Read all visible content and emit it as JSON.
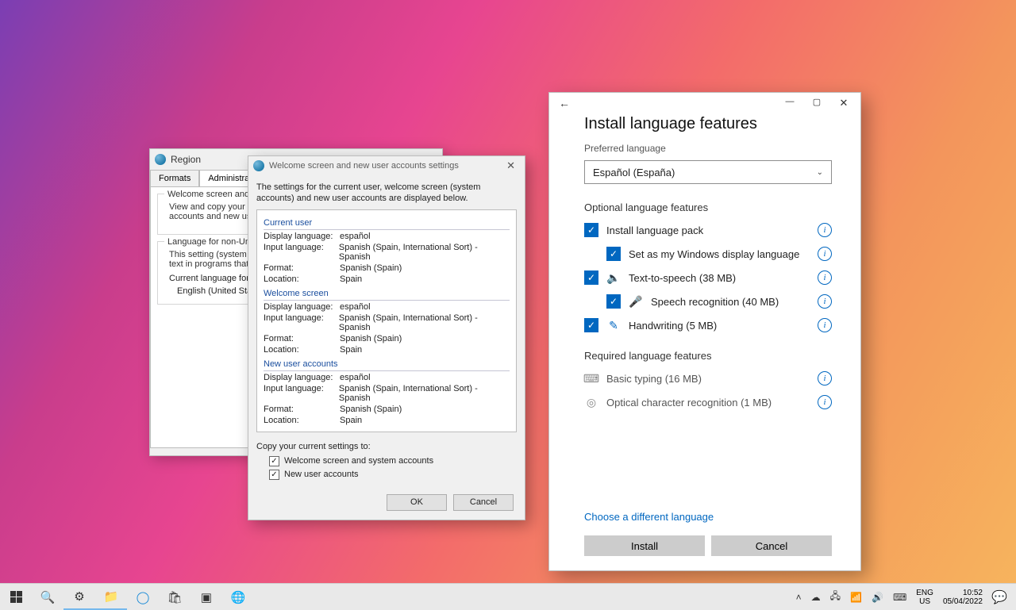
{
  "region_window": {
    "title": "Region",
    "tabs": {
      "formats": "Formats",
      "administrative": "Administrative"
    },
    "group1_title": "Welcome screen and new",
    "group1_desc": "View and copy your inte\naccounts and new user a",
    "group2_title": "Language for non-Unico",
    "group2_desc1": "This setting (system loca\ntext in programs that do",
    "group2_line3": "Current language for no",
    "group2_line4": "English (United State"
  },
  "welcome_dialog": {
    "title": "Welcome screen and new user accounts settings",
    "intro": "The settings for the current user, welcome screen (system accounts) and new user accounts are displayed below.",
    "sections": {
      "current": {
        "heading": "Current user",
        "display_language_k": "Display language:",
        "display_language_v": "español",
        "input_language_k": "Input language:",
        "input_language_v": "Spanish (Spain, International Sort) - Spanish",
        "format_k": "Format:",
        "format_v": "Spanish (Spain)",
        "location_k": "Location:",
        "location_v": "Spain"
      },
      "welcome": {
        "heading": "Welcome screen",
        "display_language_v": "español",
        "input_language_v": "Spanish (Spain, International Sort) - Spanish",
        "format_v": "Spanish (Spain)",
        "location_v": "Spain"
      },
      "newuser": {
        "heading": "New user accounts",
        "display_language_v": "español",
        "input_language_v": "Spanish (Spain, International Sort) - Spanish",
        "format_v": "Spanish (Spain)",
        "location_v": "Spain"
      }
    },
    "copy_label": "Copy your current settings to:",
    "cb1_label": "Welcome screen and system accounts",
    "cb2_label": "New user accounts",
    "ok": "OK",
    "cancel": "Cancel"
  },
  "lang_dialog": {
    "title": "Install language features",
    "preferred_label": "Preferred language",
    "dropdown_value": "Español (España)",
    "optional_heading": "Optional language features",
    "features": {
      "install_pack": "Install language pack",
      "set_display": "Set as my Windows display language",
      "tts": "Text-to-speech (38 MB)",
      "speech": "Speech recognition (40 MB)",
      "handwriting": "Handwriting (5 MB)"
    },
    "required_heading": "Required language features",
    "required": {
      "typing": "Basic typing (16 MB)",
      "ocr": "Optical character recognition (1 MB)"
    },
    "choose_diff": "Choose a different language",
    "install": "Install",
    "cancel": "Cancel"
  },
  "taskbar": {
    "lang_tag": "ENG",
    "lang_sub": "US",
    "time": "10:52",
    "date": "05/04/2022"
  }
}
